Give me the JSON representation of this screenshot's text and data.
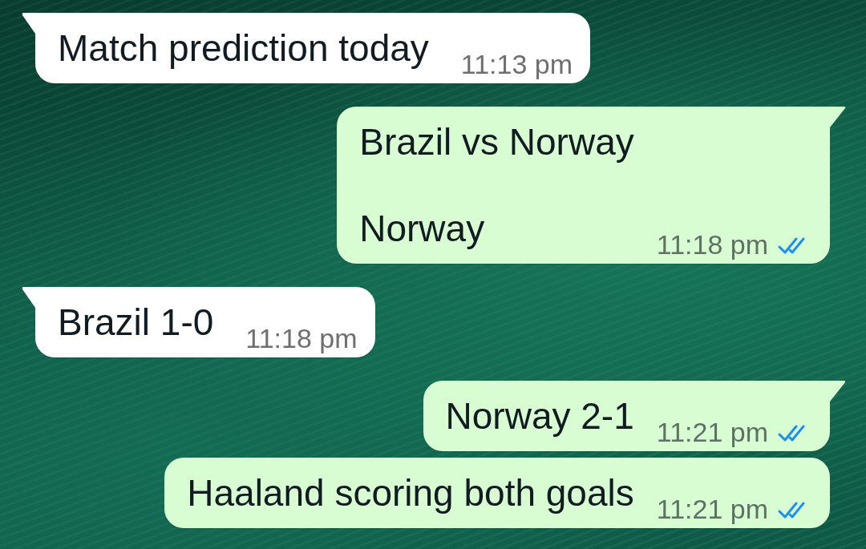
{
  "messages": [
    {
      "kind": "incoming",
      "tail": true,
      "text": "Match prediction today",
      "time": "11:13 pm"
    },
    {
      "kind": "outgoing",
      "tail": true,
      "text": "Brazil vs Norway\n\nNorway",
      "time": "11:18 pm",
      "read": true
    },
    {
      "kind": "incoming",
      "tail": true,
      "text": "Brazil 1-0",
      "time": "11:18 pm"
    },
    {
      "kind": "outgoing",
      "tail": true,
      "text": "Norway 2-1",
      "time": "11:21 pm",
      "read": true
    },
    {
      "kind": "outgoing",
      "tail": false,
      "text": "Haaland scoring both goals",
      "time": "11:21 pm",
      "read": true
    }
  ]
}
